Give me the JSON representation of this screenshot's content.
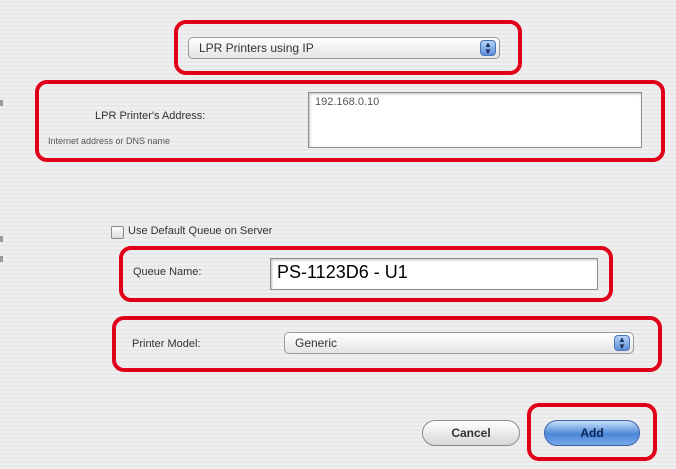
{
  "protocol_popup": {
    "value": "LPR Printers using IP"
  },
  "address": {
    "label": "LPR Printer's Address:",
    "hint": "Internet address or DNS name",
    "value": "192.168.0.10"
  },
  "default_queue": {
    "label": "Use Default Queue on Server",
    "checked": false
  },
  "queue": {
    "label": "Queue Name:",
    "value": "PS-1123D6 - U1"
  },
  "printer_model": {
    "label": "Printer Model:",
    "value": "Generic"
  },
  "buttons": {
    "cancel": "Cancel",
    "add": "Add"
  },
  "colors": {
    "highlight": "#e0001a",
    "accent": "#5b8ed6"
  }
}
